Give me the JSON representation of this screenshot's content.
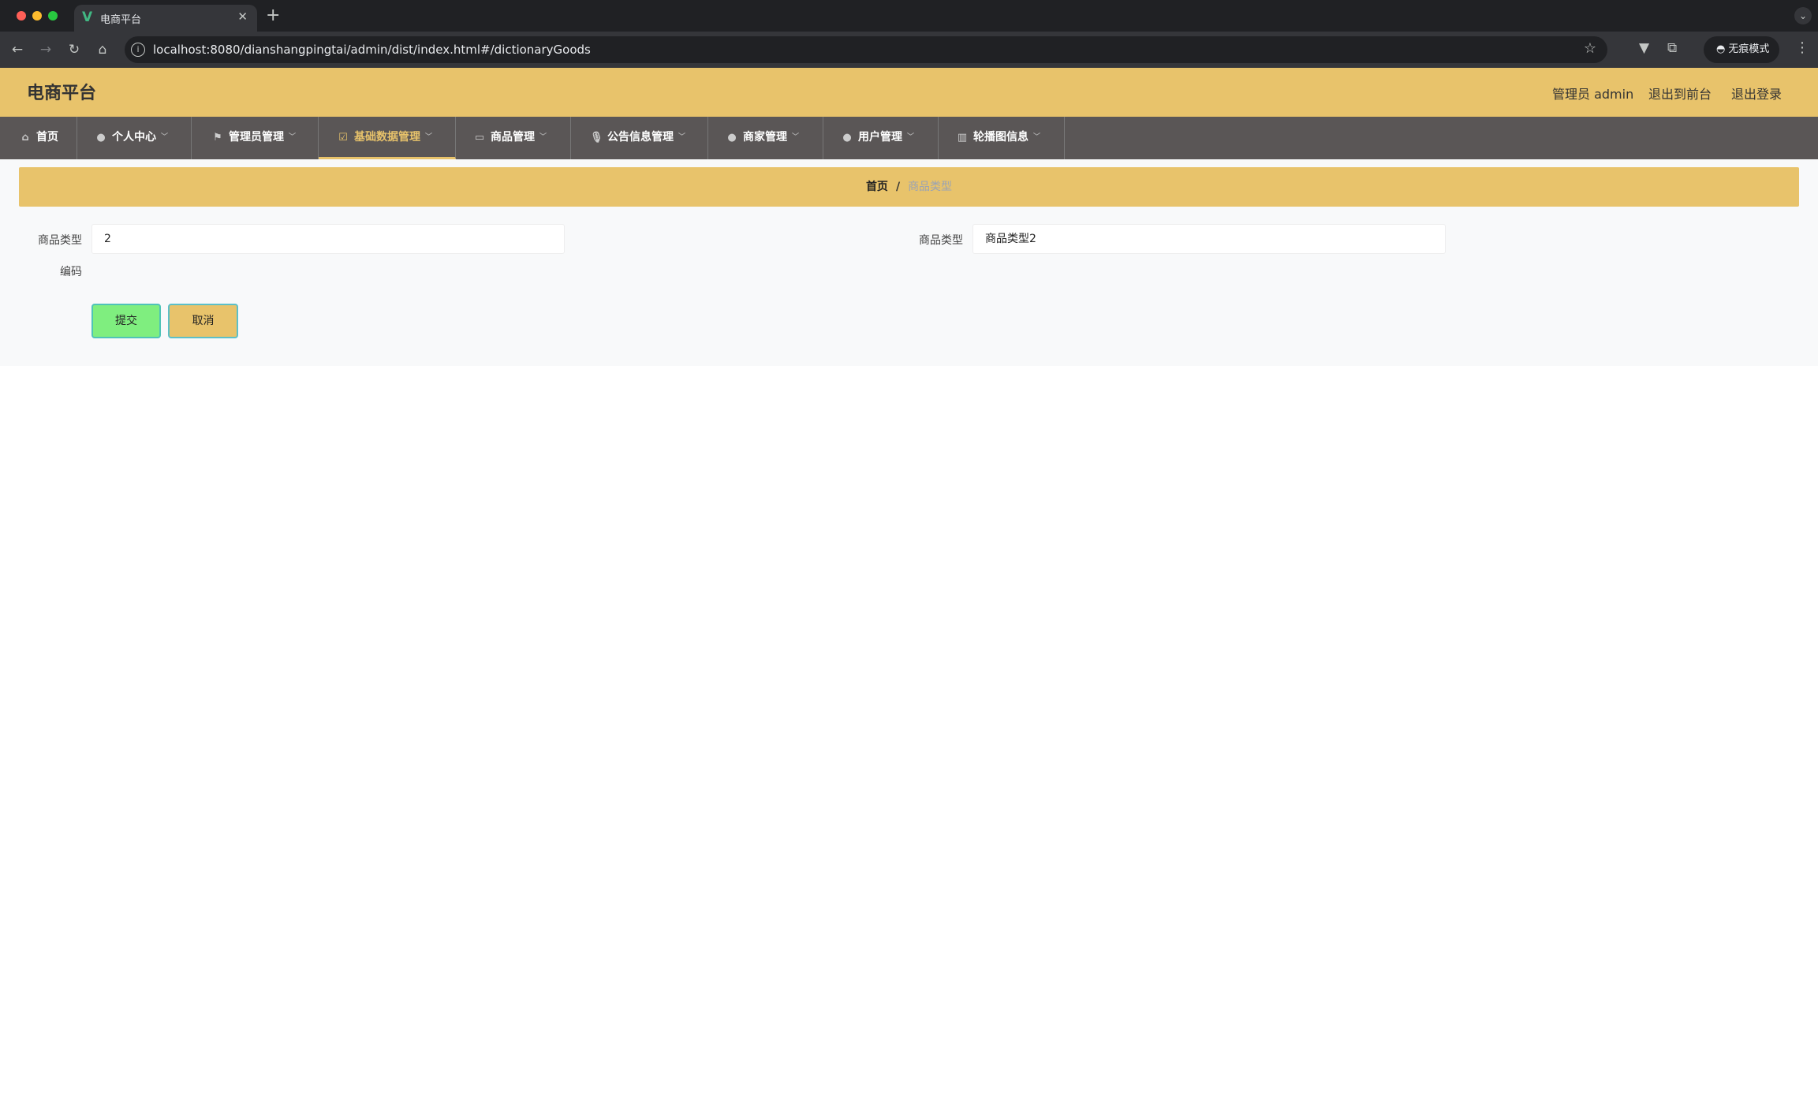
{
  "browser": {
    "tab_title": "电商平台",
    "tab_favicon": "V",
    "url": "localhost:8080/dianshangpingtai/admin/dist/index.html#/dictionaryGoods",
    "incognito_label": "无痕模式"
  },
  "header": {
    "title": "电商平台",
    "user_label": "管理员 admin",
    "exit_front_label": "退出到前台",
    "logout_label": "退出登录"
  },
  "menu": [
    {
      "label": "首页",
      "icon": "home-icon",
      "has_dropdown": false
    },
    {
      "label": "个人中心",
      "icon": "user-icon",
      "has_dropdown": true
    },
    {
      "label": "管理员管理",
      "icon": "flag-icon",
      "has_dropdown": true
    },
    {
      "label": "基础数据管理",
      "icon": "checkbox-icon",
      "has_dropdown": true,
      "active": true
    },
    {
      "label": "商品管理",
      "icon": "card-icon",
      "has_dropdown": true
    },
    {
      "label": "公告信息管理",
      "icon": "microphone-icon",
      "has_dropdown": true
    },
    {
      "label": "商家管理",
      "icon": "location-pin-icon",
      "has_dropdown": true
    },
    {
      "label": "用户管理",
      "icon": "person-icon",
      "has_dropdown": true
    },
    {
      "label": "轮播图信息",
      "icon": "bar-chart-icon",
      "has_dropdown": true
    }
  ],
  "breadcrumb": {
    "home": "首页",
    "separator": "/",
    "current": "商品类型"
  },
  "form": {
    "code_label_line1": "商品类型",
    "code_label_line2": "编码",
    "code_value": "2",
    "name_label": "商品类型",
    "name_value": "商品类型2"
  },
  "buttons": {
    "submit_label": "提交",
    "cancel_label": "取消"
  },
  "colors": {
    "accent": "#e8c36b",
    "menubar": "#5a5656",
    "submit": "#7fee7f"
  }
}
